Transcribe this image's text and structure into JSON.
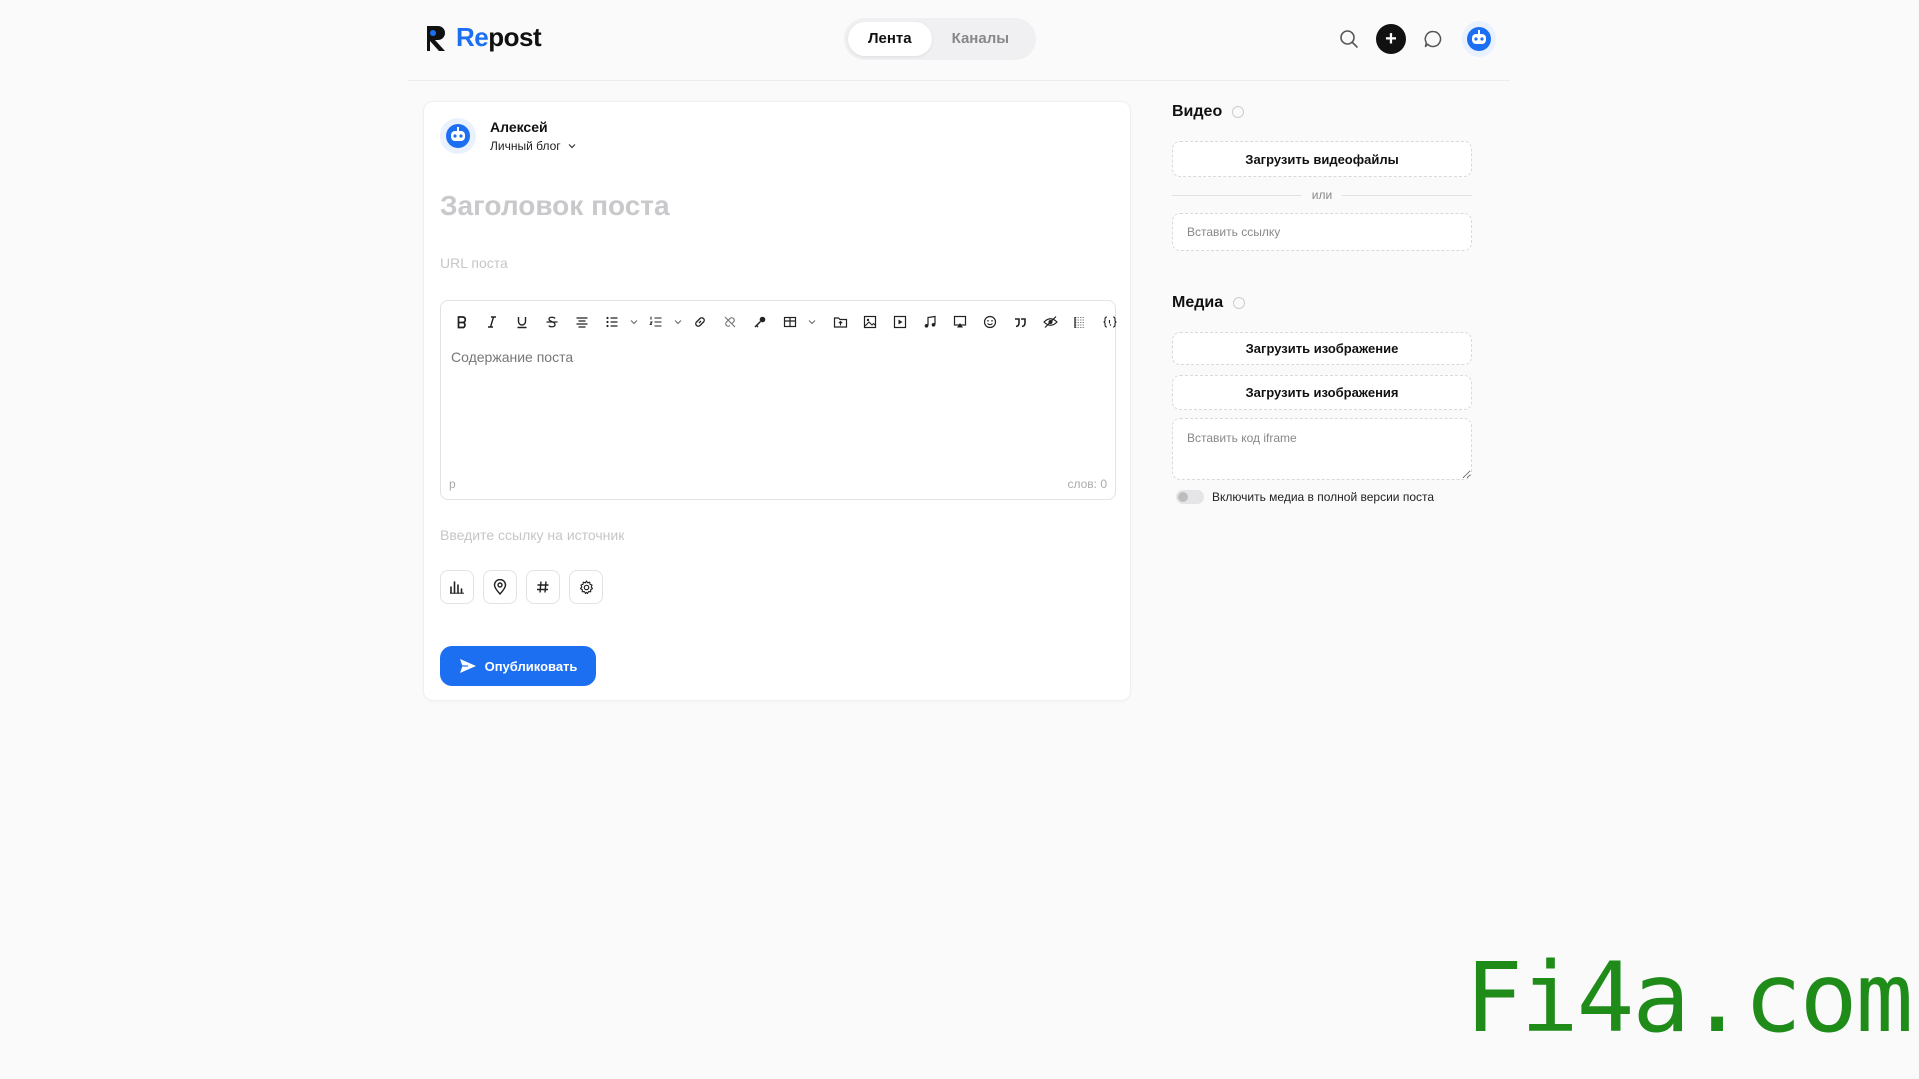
{
  "header": {
    "logo": {
      "prefix": "Re",
      "suffix": "post"
    },
    "tabs": [
      {
        "label": "Лента",
        "active": true
      },
      {
        "label": "Каналы",
        "active": false
      }
    ],
    "icons": [
      "search-icon",
      "plus-icon",
      "chat-icon",
      "robot-avatar-icon"
    ]
  },
  "composer": {
    "author": {
      "name": "Алексей",
      "blog": "Личный блог"
    },
    "title_placeholder": "Заголовок поста",
    "url_placeholder": "URL поста",
    "editor": {
      "toolbar": [
        "bold-icon",
        "italic-icon",
        "underline-icon",
        "strikethrough-icon",
        "align-center-icon",
        "bullet-list-icon",
        "chevron-down-icon",
        "numbered-list-icon",
        "chevron-down-icon",
        "link-icon",
        "unlink-icon",
        "key-icon",
        "table-icon",
        "chevron-down-icon",
        "folder-upload-icon",
        "image-icon",
        "video-icon",
        "music-icon",
        "gallery-icon",
        "emoji-icon",
        "quote-icon",
        "hide-icon",
        "spoiler-icon",
        "code-icon"
      ],
      "placeholder": "Содержание поста",
      "footer_left": "p",
      "footer_right": "слов: 0"
    },
    "source_placeholder": "Введите ссылку на источник",
    "options": [
      "poll-icon",
      "location-icon",
      "hashtag-icon",
      "settings-icon"
    ],
    "publish_label": "Опубликовать"
  },
  "sidebar": {
    "video": {
      "title": "Видео",
      "upload_label": "Загрузить видеофайлы",
      "or_label": "или",
      "link_placeholder": "Вставить ссылку"
    },
    "media": {
      "title": "Медиа",
      "upload_image_label": "Загрузить изображение",
      "upload_images_label": "Загрузить изображения",
      "iframe_placeholder": "Вставить код iframe",
      "toggle_label": "Включить медиа в полной версии поста",
      "toggle_on": false
    }
  },
  "watermark": "Fi4a.com",
  "colors": {
    "accent": "#1d6ff2",
    "watermark": "#1f8c1a"
  }
}
